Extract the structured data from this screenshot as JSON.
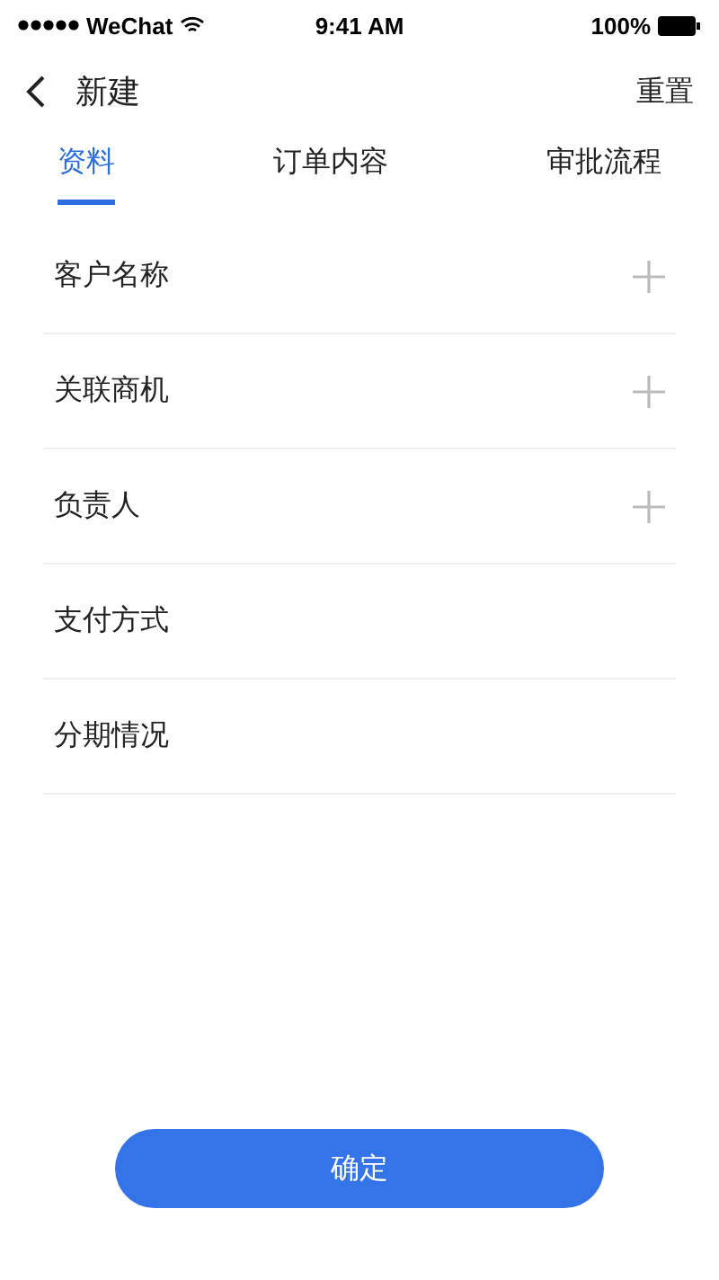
{
  "status_bar": {
    "carrier": "WeChat",
    "time": "9:41 AM",
    "battery": "100%"
  },
  "nav": {
    "title": "新建",
    "action": "重置"
  },
  "tabs": [
    {
      "label": "资料",
      "selected": true
    },
    {
      "label": "订单内容",
      "selected": false
    },
    {
      "label": "审批流程",
      "selected": false
    }
  ],
  "fields": [
    {
      "label": "客户名称",
      "addable": true
    },
    {
      "label": "关联商机",
      "addable": true
    },
    {
      "label": "负责人",
      "addable": true
    },
    {
      "label": "支付方式",
      "addable": false
    },
    {
      "label": "分期情况",
      "addable": false
    }
  ],
  "confirm_button": "确定"
}
